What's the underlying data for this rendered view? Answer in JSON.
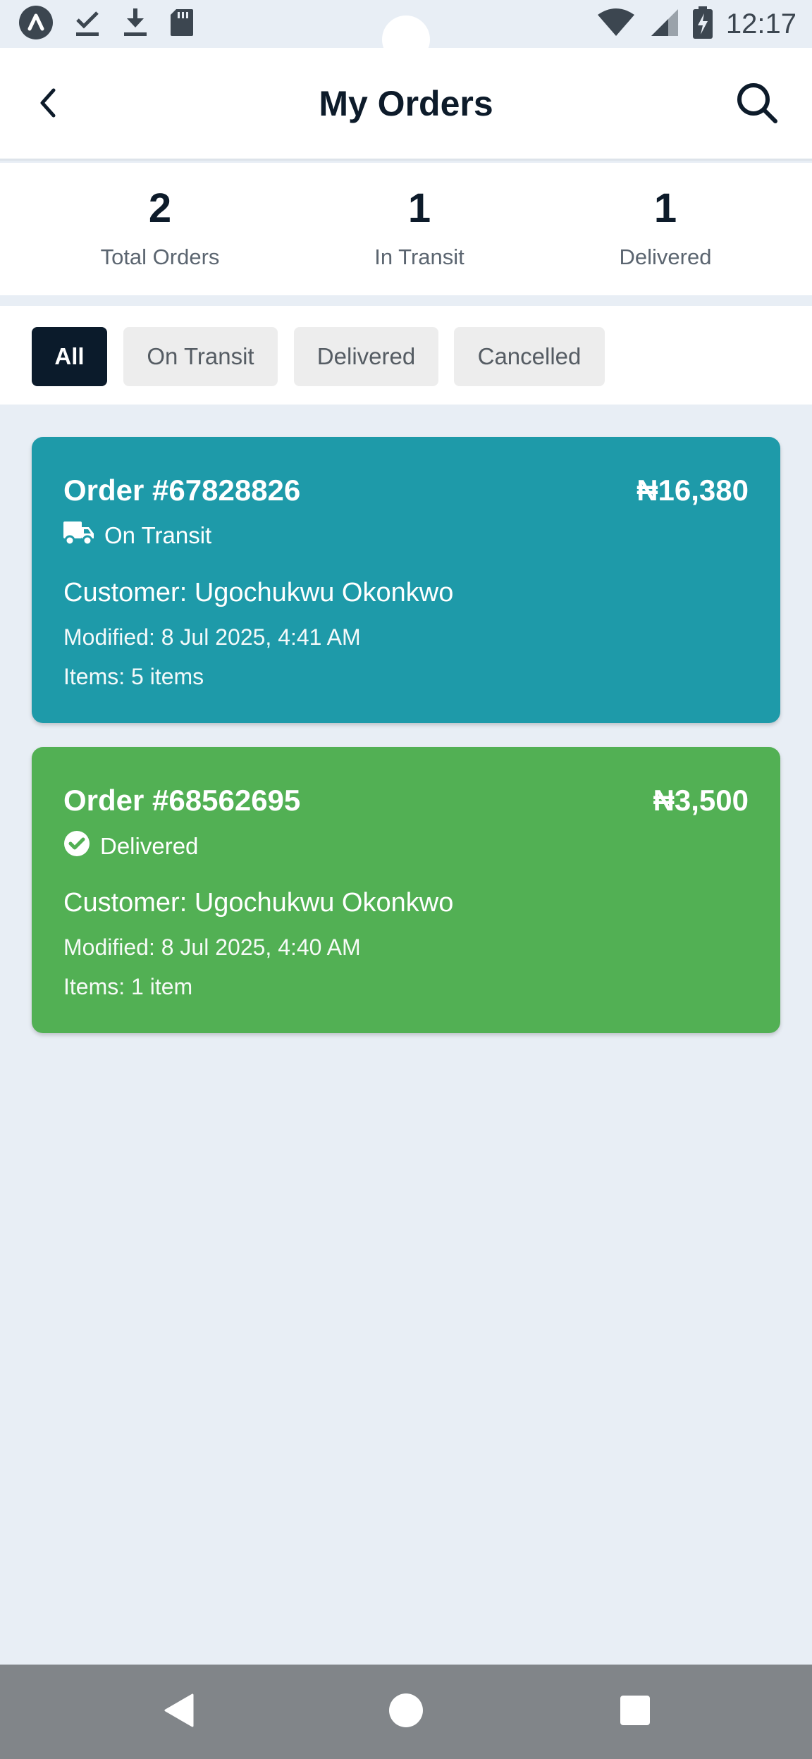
{
  "status_bar": {
    "time": "12:17",
    "icons": [
      "app-logo-icon",
      "download-done-icon",
      "download-icon",
      "sd-card-icon",
      "wifi-icon",
      "signal-icon",
      "battery-charging-icon"
    ]
  },
  "header": {
    "title": "My Orders",
    "back_icon": "chevron-left-icon",
    "search_icon": "search-icon"
  },
  "stats": [
    {
      "value": "2",
      "label": "Total Orders"
    },
    {
      "value": "1",
      "label": "In Transit"
    },
    {
      "value": "1",
      "label": "Delivered"
    }
  ],
  "filters": [
    {
      "label": "All",
      "active": true
    },
    {
      "label": "On Transit",
      "active": false
    },
    {
      "label": "Delivered",
      "active": false
    },
    {
      "label": "Cancelled",
      "active": false
    }
  ],
  "orders": [
    {
      "order_no": "Order #67828826",
      "amount": "₦16,380",
      "status": "On Transit",
      "status_icon": "truck-icon",
      "customer": "Customer: Ugochukwu Okonkwo",
      "modified": "Modified: 8 Jul 2025, 4:41 AM",
      "items": "Items: 5 items",
      "color": "#1e9aa9"
    },
    {
      "order_no": "Order #68562695",
      "amount": "₦3,500",
      "status": "Delivered",
      "status_icon": "check-circle-icon",
      "customer": "Customer: Ugochukwu Okonkwo",
      "modified": "Modified: 8 Jul 2025, 4:40 AM",
      "items": "Items: 1 item",
      "color": "#52b054"
    }
  ],
  "colors": {
    "background": "#e8eef5",
    "primary_dark": "#0b1b2b",
    "navbar": "#818589"
  },
  "navbar": {
    "icons": [
      "nav-back-icon",
      "nav-home-icon",
      "nav-recents-icon"
    ]
  }
}
